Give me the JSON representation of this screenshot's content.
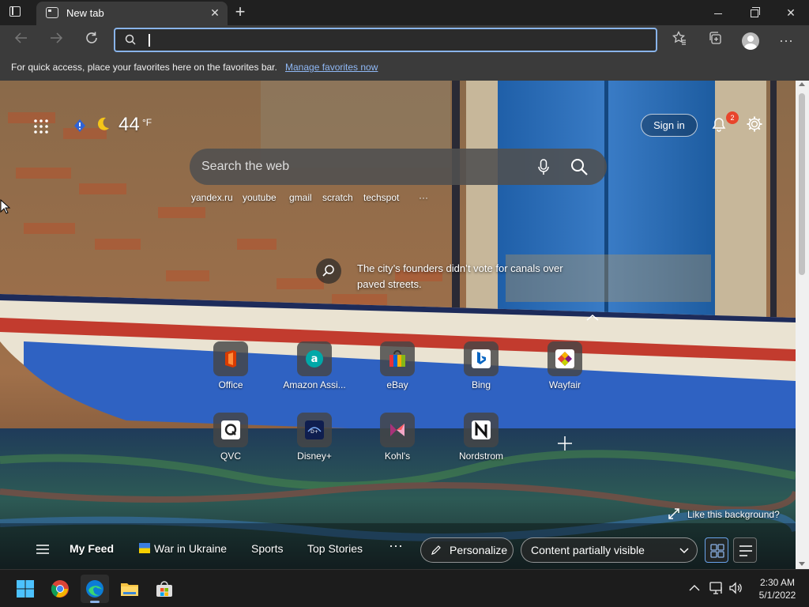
{
  "tab": {
    "title": "New tab"
  },
  "toolbar": {
    "address_value": "",
    "address_placeholder": ""
  },
  "favorites_bar": {
    "message": "For quick access, place your favorites here on the favorites bar.",
    "link": "Manage favorites now"
  },
  "weather": {
    "temperature": "44",
    "unit": "°F"
  },
  "header": {
    "signin_label": "Sign in",
    "notification_count": "2"
  },
  "search": {
    "placeholder": "Search the web"
  },
  "quick_links": [
    "yandex.ru",
    "youtube",
    "gmail",
    "scratch",
    "techspot",
    "···"
  ],
  "fact": {
    "text": "The city’s founders didn’t vote for canals over paved streets."
  },
  "tiles": [
    {
      "label": "Office",
      "color": "#d83b01"
    },
    {
      "label": "Amazon Assi...",
      "color": "#00a8a8"
    },
    {
      "label": "eBay",
      "color": "#e53238"
    },
    {
      "label": "Bing",
      "color": "#ffffff"
    },
    {
      "label": "Wayfair",
      "color": "#ffffff"
    },
    {
      "label": "QVC",
      "color": "#ffffff"
    },
    {
      "label": "Disney+",
      "color": "#1a3a8a"
    },
    {
      "label": "Kohl's",
      "color": "#ffffff"
    },
    {
      "label": "Nordstrom",
      "color": "#ffffff"
    }
  ],
  "like_background": "Like this background?",
  "feed": {
    "items": [
      "My Feed",
      "War in Ukraine",
      "Sports",
      "Top Stories"
    ],
    "more": "···",
    "personalize": "Personalize",
    "content_visibility": "Content partially visible"
  },
  "taskbar": {
    "apps": [
      "start-icon",
      "chrome-icon",
      "edge-icon",
      "file-explorer-icon",
      "store-icon"
    ],
    "time": "2:30 AM",
    "date": "5/1/2022"
  },
  "colors": {
    "accent": "#89b4ea",
    "badge": "#e8452c",
    "link": "#8fb8f5"
  }
}
